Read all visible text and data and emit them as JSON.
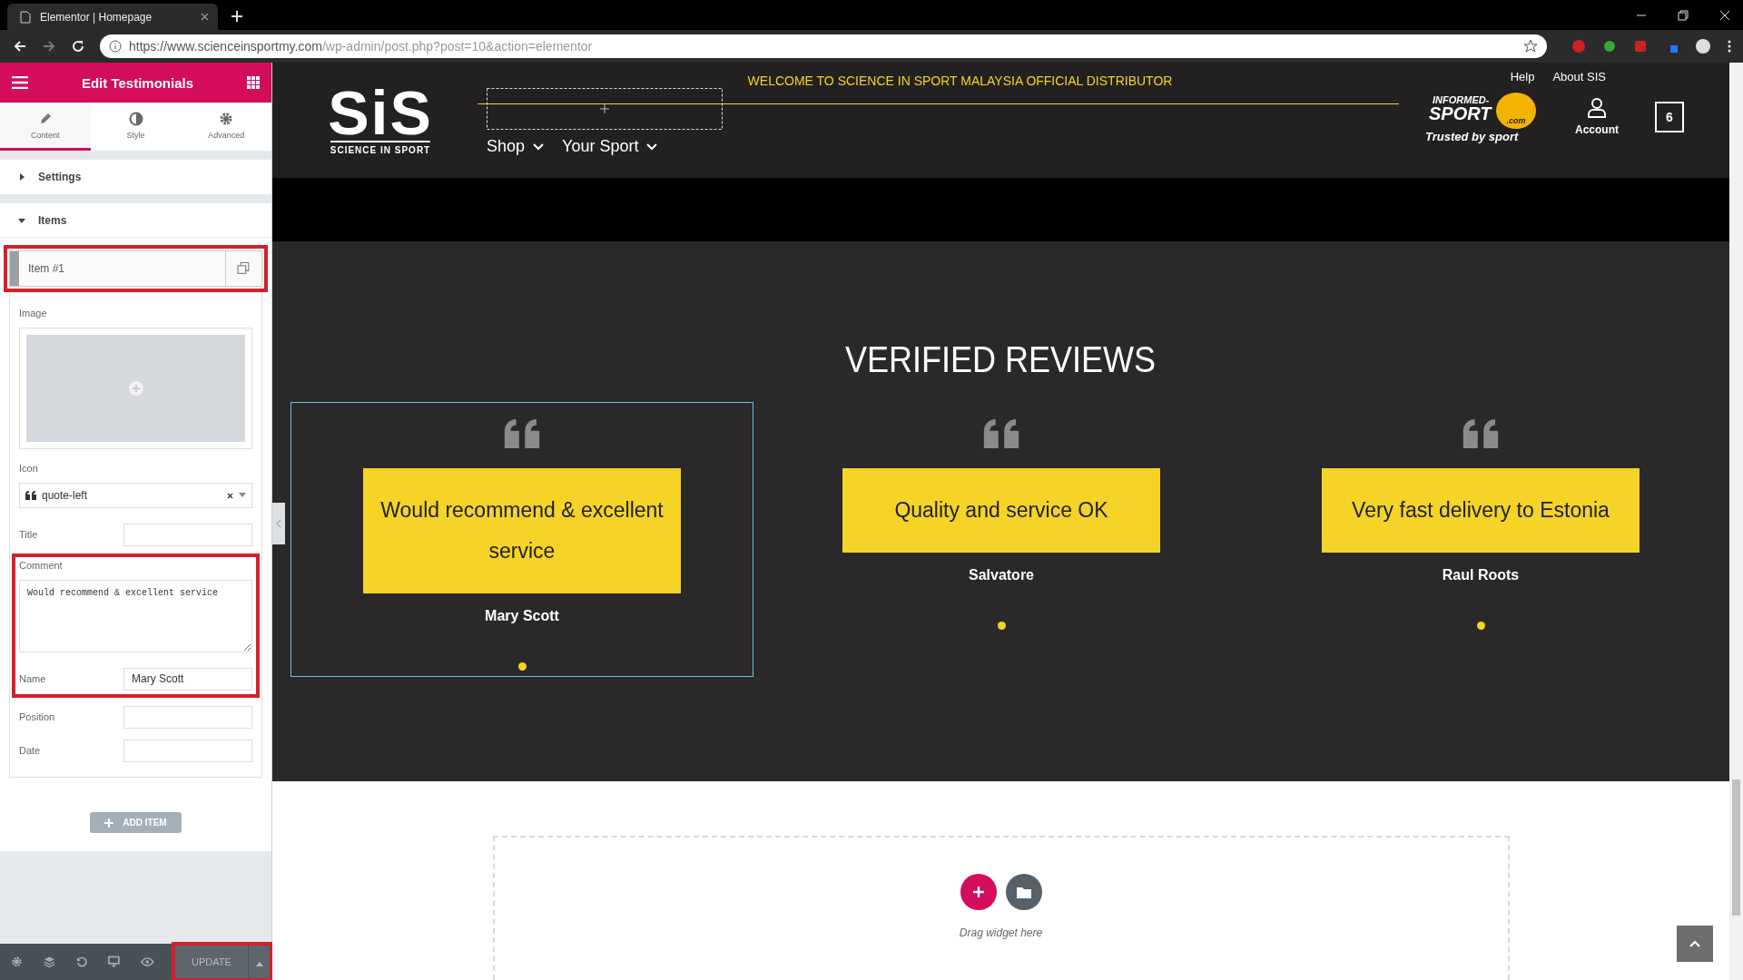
{
  "browser": {
    "tab_title": "Elementor | Homepage",
    "url_host": "https://www.scienceinsportmy.com",
    "url_path": "/wp-admin/post.php?post=10&action=elementor"
  },
  "panel": {
    "title": "Edit Testimonials",
    "tabs": [
      {
        "label": "Content",
        "selected": true
      },
      {
        "label": "Style",
        "selected": false
      },
      {
        "label": "Advanced",
        "selected": false
      }
    ],
    "sections": [
      {
        "label": "Settings",
        "expanded": false
      },
      {
        "label": "Items",
        "expanded": true
      }
    ],
    "item": {
      "label": "Item #1",
      "highlighted": true,
      "fields": [
        {
          "kind": "image",
          "label": "Image",
          "highlighted": false
        },
        {
          "kind": "select",
          "label": "Icon",
          "value": "quote-left",
          "highlighted": false
        },
        {
          "kind": "text",
          "label": "Title",
          "highlighted": false
        },
        {
          "kind": "textarea",
          "label": "Comment",
          "value": "Would recommend & excellent service",
          "highlighted": true
        },
        {
          "kind": "text",
          "label": "Name",
          "value": "Mary Scott",
          "highlighted": true
        },
        {
          "kind": "text",
          "label": "Position",
          "highlighted": false
        },
        {
          "kind": "text",
          "label": "Date",
          "highlighted": false
        }
      ]
    },
    "add_button": "ADD ITEM",
    "update_button": {
      "label": "UPDATE",
      "highlighted": true
    }
  },
  "site": {
    "welcome": "WELCOME TO SCIENCE IN SPORT MALAYSIA OFFICIAL DISTRIBUTOR",
    "logo": {
      "mark": "SiS",
      "tagline": "SCIENCE IN SPORT"
    },
    "nav": [
      "Shop",
      "Your Sport"
    ],
    "top_links": [
      "Help",
      "About SIS"
    ],
    "badge": {
      "top": "INFORMED-",
      "main": "SPORT",
      ".com": ".com",
      "tagline": "Trusted by sport"
    },
    "account": "Account",
    "cart_count": "6",
    "reviews_title": "VERIFIED REVIEWS",
    "reviews": [
      {
        "comment": "Would recommend & excellent service",
        "name": "Mary Scott",
        "selected": true
      },
      {
        "comment": "Quality and service OK",
        "name": "Salvatore",
        "selected": false
      },
      {
        "comment": "Very fast delivery to Estonia",
        "name": "Raul Roots",
        "selected": false
      }
    ],
    "dropzone": "Drag widget here"
  }
}
